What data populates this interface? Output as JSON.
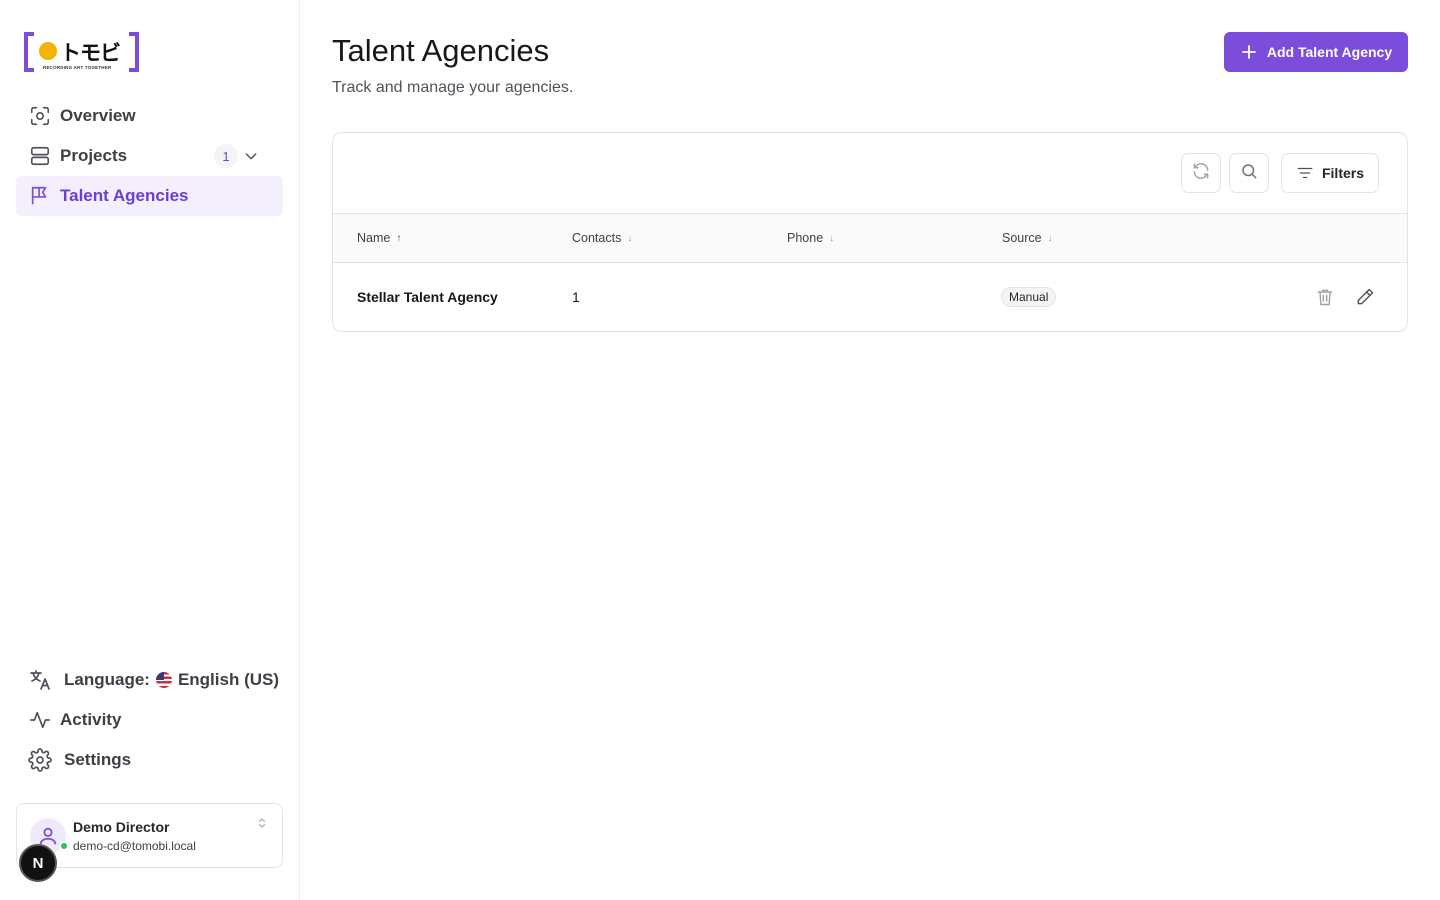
{
  "brand": {
    "logo_text": "トモビ",
    "tagline": "RECORDING ART TOGETHER",
    "accent": "#7c4ddb",
    "dot_color": "#f5b400"
  },
  "sidebar": {
    "items": [
      {
        "label": "Overview",
        "icon": "overview-icon"
      },
      {
        "label": "Projects",
        "icon": "projects-icon",
        "badge": "1"
      },
      {
        "label": "Talent Agencies",
        "icon": "flag-icon",
        "active": true
      }
    ],
    "bottom": {
      "language_label": "Language:",
      "language_value": "English (US)",
      "activity_label": "Activity",
      "settings_label": "Settings"
    },
    "user": {
      "name": "Demo Director",
      "email": "demo-cd@tomobi.local",
      "status_color": "#22c55e"
    },
    "dev_badge": "N"
  },
  "header": {
    "title": "Talent Agencies",
    "subtitle": "Track and manage your agencies.",
    "add_button": "Add Talent Agency"
  },
  "toolbar": {
    "filters_label": "Filters"
  },
  "table": {
    "columns": [
      {
        "label": "Name",
        "sort": "asc"
      },
      {
        "label": "Contacts",
        "sort": "desc"
      },
      {
        "label": "Phone",
        "sort": "desc"
      },
      {
        "label": "Source",
        "sort": "desc"
      }
    ],
    "rows": [
      {
        "name": "Stellar Talent Agency",
        "contacts": "1",
        "phone": "",
        "source": "Manual"
      }
    ]
  }
}
